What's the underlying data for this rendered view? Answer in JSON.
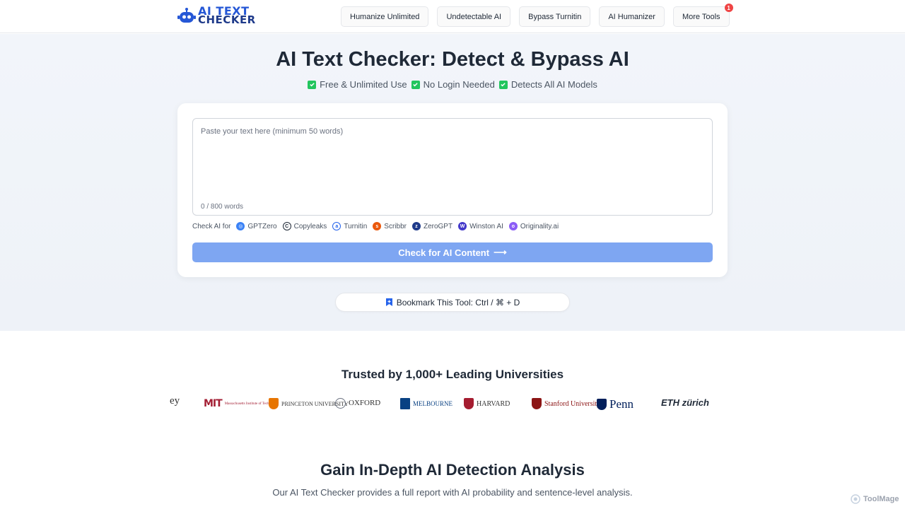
{
  "header": {
    "logo_line1": "AI TEXT",
    "logo_line2": "CHECKER",
    "nav": [
      {
        "label": "Humanize Unlimited"
      },
      {
        "label": "Undetectable AI"
      },
      {
        "label": "Bypass Turnitin"
      },
      {
        "label": "AI Humanizer"
      },
      {
        "label": "More Tools",
        "badge": "1"
      }
    ]
  },
  "hero": {
    "title": "AI Text Checker: Detect & Bypass AI",
    "features": [
      "Free & Unlimited Use",
      "No Login Needed",
      "Detects All AI Models"
    ],
    "input": {
      "placeholder": "Paste your text here (minimum 50 words)",
      "value": ""
    },
    "word_count": "0 / 800 words",
    "check_for_label": "Check AI for",
    "tools": [
      {
        "name": "GPTZero",
        "icon": "gptzero-icon",
        "color": "#3b82f6"
      },
      {
        "name": "Copyleaks",
        "icon": "copyleaks-icon",
        "color": "#1f2937"
      },
      {
        "name": "Turnitin",
        "icon": "turnitin-icon",
        "color": "#2563eb"
      },
      {
        "name": "Scribbr",
        "icon": "scribbr-icon",
        "color": "#ea580c"
      },
      {
        "name": "ZeroGPT",
        "icon": "zerogpt-icon",
        "color": "#1e3a8a"
      },
      {
        "name": "Winston AI",
        "icon": "winston-icon",
        "color": "#4338ca"
      },
      {
        "name": "Originality.ai",
        "icon": "originality-icon",
        "color": "#8b5cf6"
      }
    ],
    "submit_label": "Check for AI Content",
    "submit_arrow": "⟶",
    "bookmark_label": "Bookmark This Tool: Ctrl / ⌘ + D"
  },
  "trusted": {
    "title": "Trusted by 1,000+ Leading Universities",
    "universities": [
      {
        "name": "ey",
        "color": "#333333"
      },
      {
        "name": "MIT",
        "color": "#a31f34"
      },
      {
        "name": "PRINCETON UNIVERSITY",
        "color": "#e77500"
      },
      {
        "name": "OXFORD",
        "color": "#6b7280"
      },
      {
        "name": "MELBOURNE",
        "color": "#094183"
      },
      {
        "name": "HARVARD",
        "color": "#a51c30"
      },
      {
        "name": "Stanford University",
        "color": "#8c1515"
      },
      {
        "name": "Penn",
        "color": "#011f5b"
      },
      {
        "name": "ETH zürich",
        "color": "#1f2937"
      }
    ]
  },
  "analysis": {
    "title": "Gain In-Depth AI Detection Analysis",
    "subtitle": "Our AI Text Checker provides a full report with AI probability and sentence-level analysis."
  },
  "watermark": "ToolMage"
}
